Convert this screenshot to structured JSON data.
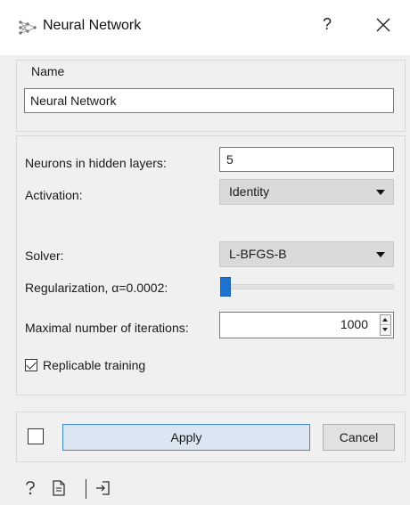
{
  "window": {
    "title": "Neural Network",
    "help_glyph": "?",
    "icons": {
      "app": "neural-network-icon",
      "close": "close-icon"
    }
  },
  "name_box": {
    "legend": "Name",
    "value": "Neural Network"
  },
  "params": {
    "hidden_layers": {
      "label": "Neurons in hidden layers:",
      "value": "5"
    },
    "activation": {
      "label": "Activation:",
      "value": "Identity"
    },
    "solver": {
      "label": "Solver:",
      "value": "L-BFGS-B"
    },
    "regularization": {
      "label": "Regularization, α=0.0002:",
      "slider_fraction": 0.0
    },
    "max_iter": {
      "label": "Maximal number of iterations:",
      "value": "1000"
    },
    "replicable": {
      "label": "Replicable training",
      "checked": true
    }
  },
  "actions": {
    "auto_apply_checked": false,
    "apply_label": "Apply",
    "cancel_label": "Cancel"
  },
  "statusbar": {
    "icons": [
      "help-icon",
      "report-icon",
      "output-icon"
    ]
  },
  "colors": {
    "accent": "#1f73d0",
    "apply_bg": "#dbe6f2",
    "apply_border": "#3c88d6"
  }
}
